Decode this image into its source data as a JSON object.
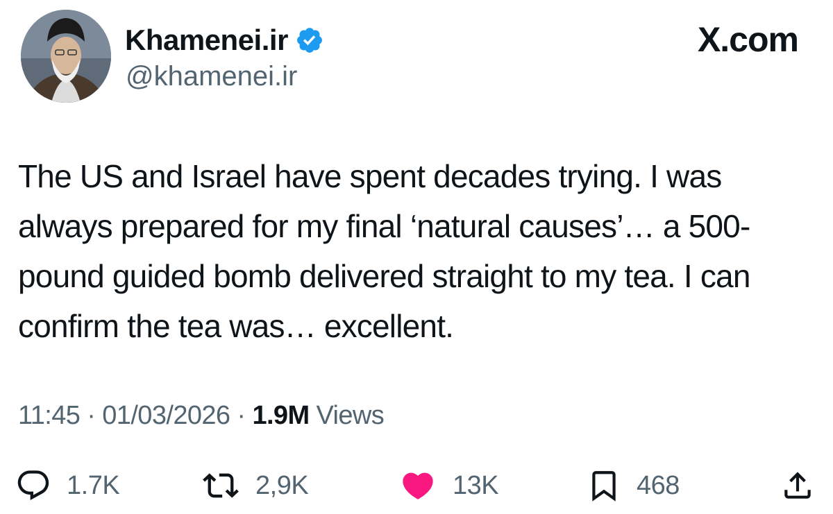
{
  "author": {
    "display_name": "Khamenei.ir",
    "handle": "@khamenei.ir",
    "verified": true
  },
  "site_label": "X.com",
  "tweet": {
    "text": "The US and Israel have spent decades trying. I was always prepared for my final ‘natural causes’… a 500-pound guided bomb delivered straight to my tea. I can confirm the tea was… excellent."
  },
  "meta": {
    "time": "11:45",
    "separator": " · ",
    "date": "01/03/2026",
    "views_count": "1.9M",
    "views_label": " Views"
  },
  "actions": {
    "replies": "1.7K",
    "reposts": "2,9K",
    "likes": "13K",
    "bookmarks": "468"
  },
  "colors": {
    "text": "#0f1419",
    "secondary": "#536471",
    "verified_blue": "#1d9bf0",
    "like_pink": "#f91880"
  },
  "icons": {
    "verified": "verified-badge-icon",
    "reply": "reply-bubble-icon",
    "repost": "repost-arrows-icon",
    "like": "heart-filled-icon",
    "bookmark": "bookmark-icon",
    "share": "share-icon"
  }
}
